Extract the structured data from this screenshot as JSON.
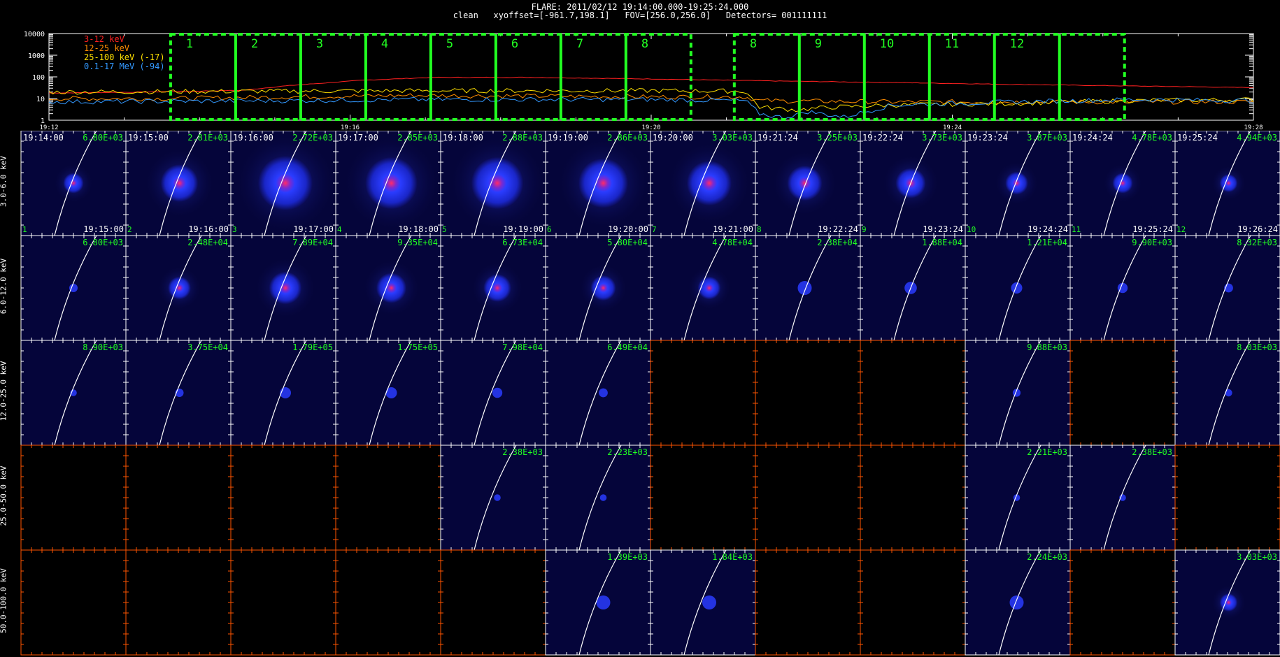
{
  "header": {
    "title": "FLARE: 2011/02/12 19:14:00.000-19:25:24.000",
    "subtitle": "clean   xyoffset=[-961.7,198.1]   FOV=[256.0,256.0]   Detectors= 001111111"
  },
  "colors": {
    "background": "#000000",
    "frame": "#ffffff",
    "interval_box": "#22ff22",
    "annotation": "#22ff22",
    "empty_axis": "#ff5500",
    "limb": "#ffffff"
  },
  "chart_data": [
    {
      "type": "line",
      "name": "lightcurve",
      "yscale": "log",
      "ylim": [
        1,
        10000
      ],
      "yticks": [
        "10000",
        "1000",
        "100",
        "10",
        "1"
      ],
      "xlim_minutes": [
        19.2,
        19.483
      ],
      "xticks": [
        "19:12",
        "19:16",
        "19:20",
        "19:24",
        "19:28"
      ],
      "series": [
        {
          "name": "3-12 keV",
          "color": "#ff2020",
          "points": [
            [
              0,
              18
            ],
            [
              0.08,
              20
            ],
            [
              0.16,
              24
            ],
            [
              0.2,
              40
            ],
            [
              0.26,
              70
            ],
            [
              0.32,
              95
            ],
            [
              0.4,
              95
            ],
            [
              0.5,
              80
            ],
            [
              0.6,
              65
            ],
            [
              0.7,
              55
            ],
            [
              0.8,
              45
            ],
            [
              0.9,
              38
            ],
            [
              1.0,
              32
            ]
          ]
        },
        {
          "name": "12-25 keV",
          "color": "#ff8c00",
          "points": [
            [
              0,
              10
            ],
            [
              0.1,
              10
            ],
            [
              0.2,
              12
            ],
            [
              0.3,
              14
            ],
            [
              0.4,
              13
            ],
            [
              0.5,
              12
            ],
            [
              0.578,
              12
            ],
            [
              0.59,
              8
            ],
            [
              0.7,
              7
            ],
            [
              0.8,
              7
            ],
            [
              0.9,
              7
            ],
            [
              1.0,
              7
            ]
          ]
        },
        {
          "name": "25-100 keV (-17)",
          "color": "#ffe000",
          "points": [
            [
              0,
              20
            ],
            [
              0.1,
              21
            ],
            [
              0.2,
              22
            ],
            [
              0.3,
              23
            ],
            [
              0.4,
              23
            ],
            [
              0.5,
              23
            ],
            [
              0.578,
              22
            ],
            [
              0.59,
              4
            ],
            [
              0.62,
              3
            ],
            [
              0.65,
              4
            ],
            [
              0.7,
              5
            ],
            [
              0.8,
              6
            ],
            [
              0.9,
              8
            ],
            [
              1.0,
              9
            ]
          ]
        },
        {
          "name": "0.1-17 MeV (-94)",
          "color": "#3399ff",
          "points": [
            [
              0,
              7
            ],
            [
              0.1,
              7.5
            ],
            [
              0.2,
              8
            ],
            [
              0.3,
              9
            ],
            [
              0.4,
              9
            ],
            [
              0.5,
              9
            ],
            [
              0.578,
              8
            ],
            [
              0.59,
              2
            ],
            [
              0.61,
              1.3
            ],
            [
              0.63,
              2.5
            ],
            [
              0.66,
              1.4
            ],
            [
              0.7,
              5
            ],
            [
              0.8,
              7
            ],
            [
              0.9,
              9
            ],
            [
              1.0,
              8
            ]
          ]
        }
      ],
      "intervals": [
        "1",
        "2",
        "3",
        "4",
        "5",
        "6",
        "7",
        "8",
        "9",
        "10",
        "11",
        "12"
      ]
    },
    {
      "type": "heatmap",
      "name": "image_grid",
      "rows": [
        "3.0-6.0 keV",
        "6.0-12.0 keV",
        "12.0-25.0 keV",
        "25.0-50.0 keV",
        "50.0-100.0 keV"
      ],
      "start_times": [
        "19:14:00",
        "19:15:00",
        "19:16:00",
        "19:17:00",
        "19:18:00",
        "19:19:00",
        "19:20:00",
        "19:21:24",
        "19:22:24",
        "19:23:24",
        "19:24:24",
        "19:25:24"
      ],
      "end_times": [
        "19:15:00",
        "19:16:00",
        "19:17:00",
        "19:18:00",
        "19:19:00",
        "19:20:00",
        "19:21:00",
        "19:22:24",
        "19:23:24",
        "19:24:24",
        "19:25:24",
        "19:26:24"
      ],
      "panel_numbers": [
        "1",
        "2",
        "3",
        "4",
        "5",
        "6",
        "7",
        "8",
        "9",
        "10",
        "11",
        "12"
      ],
      "peaks": [
        [
          "6.80E+03",
          "2.81E+03",
          "2.72E+03",
          "2.85E+03",
          "2.88E+03",
          "2.86E+03",
          "3.03E+03",
          "3.25E+03",
          "3.73E+03",
          "3.87E+03",
          "4.78E+03",
          "4.94E+03"
        ],
        [
          "6.80E+03",
          "2.48E+04",
          "7.89E+04",
          "9.35E+04",
          "6.73E+04",
          "5.80E+04",
          "4.78E+04",
          "2.38E+04",
          "1.88E+04",
          "1.21E+04",
          "9.90E+03",
          "8.32E+03"
        ],
        [
          "8.90E+03",
          "3.75E+04",
          "1.79E+05",
          "1.75E+05",
          "7.98E+04",
          "6.49E+04",
          "",
          "",
          "",
          "9.88E+03",
          "",
          "8.03E+03"
        ],
        [
          "",
          "",
          "",
          "",
          "2.38E+03",
          "2.23E+03",
          "",
          "",
          "",
          "2.21E+03",
          "2.38E+03",
          ""
        ],
        [
          "",
          "",
          "",
          "",
          "",
          "1.39E+03",
          "1.84E+03",
          "",
          "",
          "2.24E+03",
          "",
          "3.03E+03"
        ]
      ],
      "source_intensity": [
        [
          0.25,
          0.6,
          0.95,
          0.9,
          0.9,
          0.85,
          0.75,
          0.55,
          0.45,
          0.3,
          0.25,
          0.2
        ],
        [
          0.05,
          0.3,
          0.5,
          0.45,
          0.4,
          0.35,
          0.3,
          0.15,
          0.12,
          0.1,
          0.08,
          0.06
        ],
        [
          0.02,
          0.05,
          0.1,
          0.1,
          0.08,
          0.06,
          0,
          0,
          0,
          0.04,
          0,
          0.03
        ],
        [
          0,
          0,
          0,
          0,
          0.02,
          0.02,
          0,
          0,
          0,
          0.02,
          0.02,
          0
        ],
        [
          0,
          0,
          0,
          0,
          0,
          0.15,
          0.15,
          0,
          0,
          0.15,
          0,
          0.2
        ]
      ]
    }
  ]
}
